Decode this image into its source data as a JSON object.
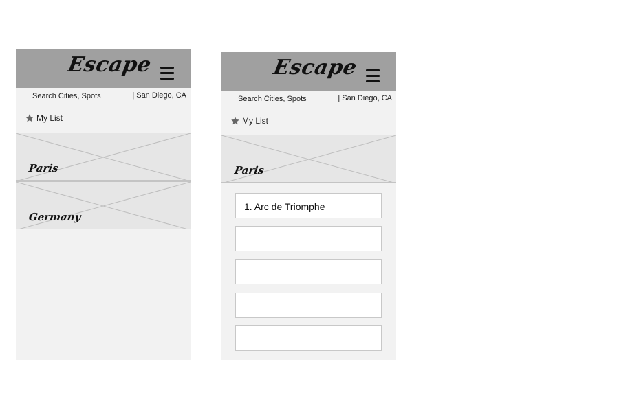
{
  "app": {
    "logo": "Escape"
  },
  "header": {
    "search_placeholder": "Search Cities, Spots",
    "location": "| San Diego, CA",
    "my_list_label": "My List"
  },
  "screen1": {
    "cards": [
      {
        "label": "Paris"
      },
      {
        "label": "Germany"
      }
    ]
  },
  "screen2": {
    "card": {
      "label": "Paris"
    },
    "spots": [
      {
        "label": "1. Arc de Triomphe"
      },
      {
        "label": ""
      },
      {
        "label": ""
      },
      {
        "label": ""
      },
      {
        "label": ""
      }
    ]
  },
  "icons": {
    "menu": "hamburger-menu-icon",
    "star": "star-icon"
  },
  "colors": {
    "header_bg": "#a0a0a0",
    "screen_bg": "#f2f2f2",
    "card_bg": "#e6e6e6"
  }
}
